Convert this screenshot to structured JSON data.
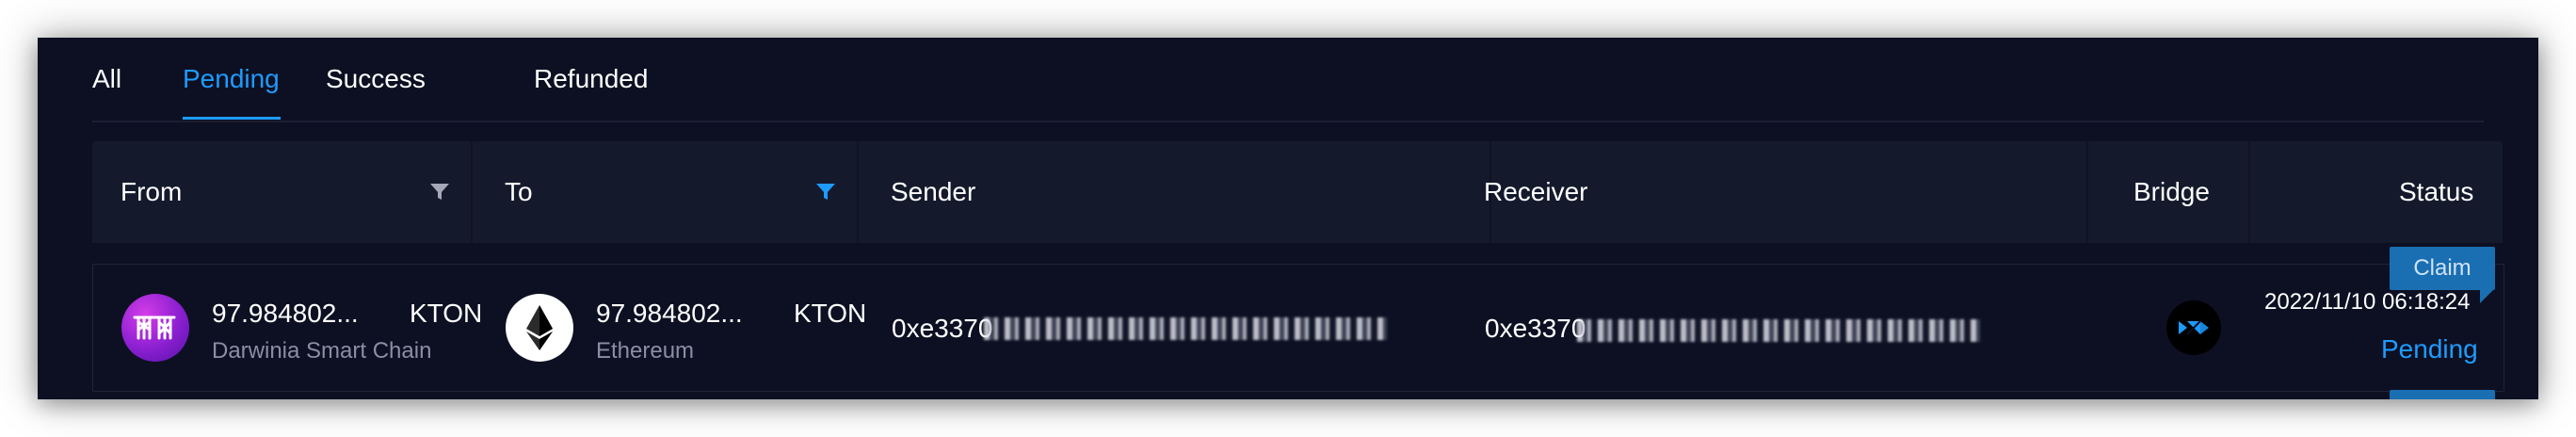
{
  "tabs": [
    {
      "label": "All"
    },
    {
      "label": "Pending"
    },
    {
      "label": "Success"
    },
    {
      "label": "Refunded"
    }
  ],
  "table": {
    "columns": {
      "from": "From",
      "to": "To",
      "sender": "Sender",
      "receiver": "Receiver",
      "bridge": "Bridge",
      "status": "Status"
    },
    "rows": [
      {
        "from": {
          "amount": "97.984802...",
          "token": "KTON",
          "chain": "Darwinia Smart Chain",
          "icon": "darwinia-icon"
        },
        "to": {
          "amount": "97.984802...",
          "token": "KTON",
          "chain": "Ethereum",
          "icon": "ethereum-icon"
        },
        "sender": {
          "prefix": "0xe3370"
        },
        "receiver": {
          "prefix": "0xe3370"
        },
        "bridge": {
          "icon": "bridge-logo-icon"
        },
        "status": {
          "date": "2022/11/10 06:18:24",
          "label": "Pending"
        },
        "action": {
          "claim_label": "Claim"
        }
      }
    ]
  },
  "colors": {
    "accent": "#1e9bff",
    "background": "#0d1022",
    "header_bg": "#141a2c",
    "claim_bg": "#1a6fb3"
  }
}
